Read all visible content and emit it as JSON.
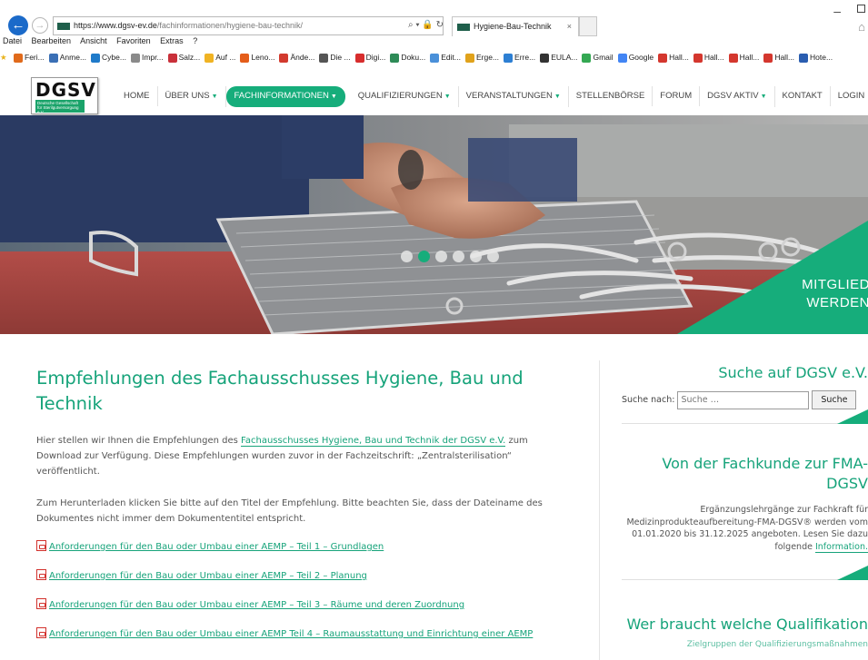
{
  "browser": {
    "url_prefix": "https://www.",
    "url_host": "dgsv-ev.de",
    "url_path": "/fachinformationen/hygiene-bau-technik/",
    "address_tools": "⌕ ▾ ὑ2 ↻",
    "tab_title": "Hygiene-Bau-Technik",
    "tab_close": "×",
    "menu": [
      "Datei",
      "Bearbeiten",
      "Ansicht",
      "Favoriten",
      "Extras",
      "?"
    ],
    "favorites": [
      {
        "label": "Feri...",
        "color": "#e06a1b"
      },
      {
        "label": "Anme...",
        "color": "#3a6fb5"
      },
      {
        "label": "Cybe...",
        "color": "#1f7ac9"
      },
      {
        "label": "Impr...",
        "color": "#8a8a8a"
      },
      {
        "label": "Salz...",
        "color": "#c9303a"
      },
      {
        "label": "Auf ...",
        "color": "#f0b323"
      },
      {
        "label": "Leno...",
        "color": "#e45d1a"
      },
      {
        "label": "Ände...",
        "color": "#d23a2e"
      },
      {
        "label": "Die ...",
        "color": "#555555"
      },
      {
        "label": "Digi...",
        "color": "#d72d2d"
      },
      {
        "label": "Doku...",
        "color": "#2e8b57"
      },
      {
        "label": "Edit...",
        "color": "#4a90d9"
      },
      {
        "label": "Erge...",
        "color": "#e0a21b"
      },
      {
        "label": "Erre...",
        "color": "#2d7fd3"
      },
      {
        "label": "EULA...",
        "color": "#333333"
      },
      {
        "label": "Gmail",
        "color": "#34a853"
      },
      {
        "label": "Google",
        "color": "#4285f4"
      },
      {
        "label": "Hall...",
        "color": "#d4372e"
      },
      {
        "label": "Hall...",
        "color": "#d4372e"
      },
      {
        "label": "Hall...",
        "color": "#d4372e"
      },
      {
        "label": "Hall...",
        "color": "#d4372e"
      },
      {
        "label": "Hote...",
        "color": "#2a5db0"
      }
    ]
  },
  "site": {
    "logo": "DGSV",
    "logo_sub": "Deutsche Gesellschaft für Sterilgutversorgung e.V.",
    "nav": [
      {
        "label": "HOME",
        "caret": ""
      },
      {
        "label": "ÜBER UNS",
        "caret": "▼"
      },
      {
        "label": "FACHINFORMATIONEN",
        "caret": "▼"
      },
      {
        "label": "QUALIFIZIERUNGEN",
        "caret": "▼"
      },
      {
        "label": "VERANSTALTUNGEN",
        "caret": "▼"
      },
      {
        "label": "STELLENBÖRSE",
        "caret": ""
      },
      {
        "label": "FORUM",
        "caret": ""
      },
      {
        "label": "DGSV AKTIV",
        "caret": "▼"
      },
      {
        "label": "KONTAKT",
        "caret": ""
      },
      {
        "label": "LOGIN",
        "caret": ""
      }
    ],
    "accent": "#16ad7b"
  },
  "hero": {
    "slides_total": 6,
    "active_slide": 2,
    "cta_line1": "MITGLIED",
    "cta_line2": "WERDEN"
  },
  "main": {
    "title": "Empfehlungen des Fachausschusses Hygiene, Bau und Technik",
    "intro_before": "Hier stellen wir Ihnen die Empfehlungen des ",
    "intro_link": "Fachausschusses Hygiene, Bau und Technik der DGSV e.V.",
    "intro_after": " zum Download zur Verfügung. Diese Empfehlungen wurden zuvor in der Fachzeitschrift: „Zentralsterilisation“ veröffentlicht.",
    "instructions": "Zum Herunterladen klicken Sie bitte auf den Titel der Empfehlung. Bitte beachten Sie, dass der Dateiname des Dokumentes nicht immer dem Dokumententitel entspricht.",
    "documents": [
      "Anforderungen für den Bau oder Umbau einer AEMP – Teil 1 – Grundlagen",
      "Anforderungen für den Bau oder Umbau einer AEMP – Teil 2 – Planung",
      "Anforderungen für den Bau oder Umbau einer AEMP – Teil 3 – Räume und deren Zuordnung",
      "Anforderungen für den Bau oder Umbau einer AEMP Teil 4 – Raumausstattung und Einrichtung einer AEMP"
    ]
  },
  "sidebar": {
    "search_title": "Suche auf DGSV e.V.",
    "search_label": "Suche nach:",
    "search_placeholder": "Suche …",
    "search_button": "Suche",
    "fk_title": "Von der Fachkunde zur FMA-DGSV",
    "fk_text": "Ergänzungslehrgänge zur Fachkraft für Medizinprodukteaufbereitung-FMA-DGSV® werden vom 01.01.2020 bis 31.12.2025 angeboten. Lesen Sie dazu folgende ",
    "fk_link": "Information.",
    "q_title": "Wer braucht welche Qualifikation",
    "q_sub": "Zielgruppen der Qualifizierungsmaßnahmen"
  }
}
